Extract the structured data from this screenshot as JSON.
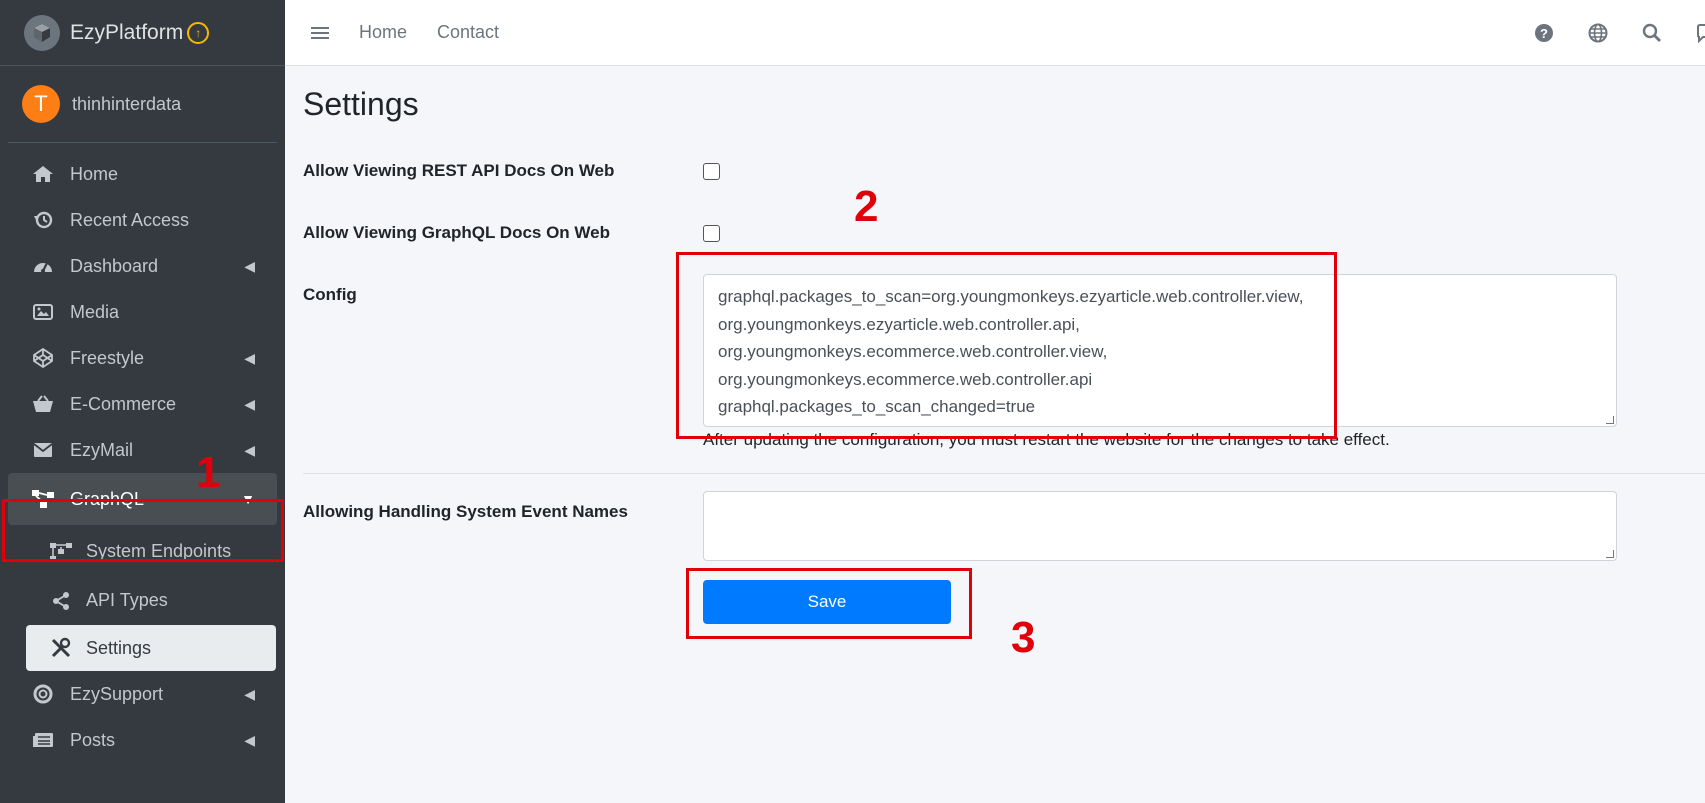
{
  "brand": {
    "name": "EzyPlatform",
    "logo_icon": "cube-logo-icon",
    "upgrade_icon": "arrow-up-circle-icon"
  },
  "user": {
    "avatar_letter": "T",
    "name": "thinhinterdata"
  },
  "sidebar": {
    "items": [
      {
        "label": "Home",
        "icon": "home-icon"
      },
      {
        "label": "Recent Access",
        "icon": "history-icon"
      },
      {
        "label": "Dashboard",
        "icon": "gauge-icon"
      },
      {
        "label": "Media",
        "icon": "image-icon"
      },
      {
        "label": "Freestyle",
        "icon": "codepen-icon"
      },
      {
        "label": "E-Commerce",
        "icon": "basket-icon"
      },
      {
        "label": "EzyMail",
        "icon": "envelope-icon"
      },
      {
        "label": "GraphQL",
        "icon": "sitemap-icon"
      },
      {
        "label": "EzySupport",
        "icon": "life-ring-icon"
      },
      {
        "label": "Posts",
        "icon": "newspaper-icon"
      }
    ],
    "graphql_sub": [
      {
        "label": "System Endpoints",
        "icon": "endpoints-icon"
      },
      {
        "label": "API Types",
        "icon": "share-icon"
      },
      {
        "label": "Settings",
        "icon": "tools-icon"
      }
    ]
  },
  "topbar": {
    "home": "Home",
    "contact": "Contact"
  },
  "page": {
    "title": "Settings",
    "rest_label": "Allow Viewing REST API Docs On Web",
    "graphql_label": "Allow Viewing GraphQL Docs On Web",
    "config_label": "Config",
    "config_lines": [
      "graphql.packages_to_scan=org.youngmonkeys.ezyarticle.web.controller.view,",
      "org.youngmonkeys.ezyarticle.web.controller.api,",
      "org.youngmonkeys.ecommerce.web.controller.view,",
      "org.youngmonkeys.ecommerce.web.controller.api",
      "graphql.packages_to_scan_changed=true"
    ],
    "config_help": "After updating the configuration, you must restart the website for the changes to take effect.",
    "events_label": "Allowing Handling System Event Names",
    "events_value": "",
    "save_label": "Save"
  },
  "annotations": {
    "one": "1",
    "two": "2",
    "three": "3"
  },
  "colors": {
    "sidebar_bg": "#343a40",
    "primary": "#007bff",
    "annotation": "#e0000a",
    "avatar": "#fd7e14"
  }
}
